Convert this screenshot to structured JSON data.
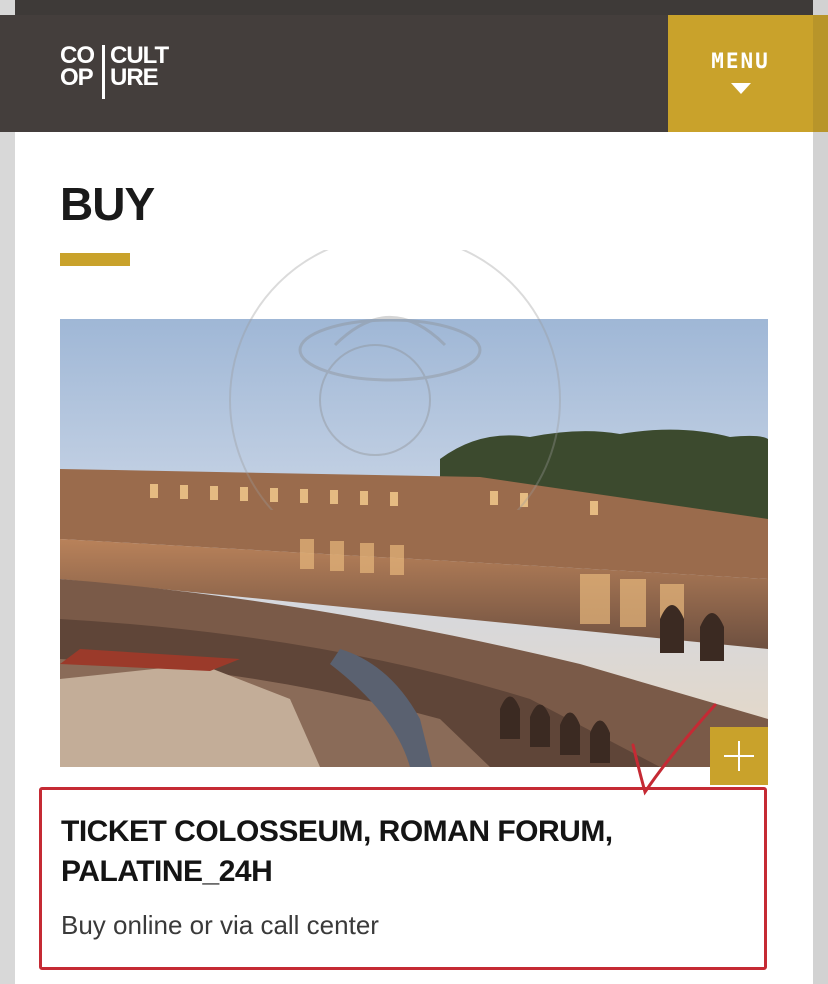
{
  "header": {
    "logo": {
      "left_line1": "CO",
      "left_line2": "OP",
      "right_line1": "CULT",
      "right_line2": "URE"
    },
    "menu_label": "MENU"
  },
  "page": {
    "title": "BUY"
  },
  "ticket": {
    "title": "TICKET COLOSSEUM, ROMAN FORUM, PALATINE_24H",
    "subtitle": "Buy online or via call center"
  },
  "colors": {
    "header_bg": "#443e3c",
    "accent_gold": "#c9a22b",
    "highlight_red": "#c52a34"
  },
  "icons": {
    "menu_caret": "caret-down-icon",
    "expand": "plus-icon"
  }
}
